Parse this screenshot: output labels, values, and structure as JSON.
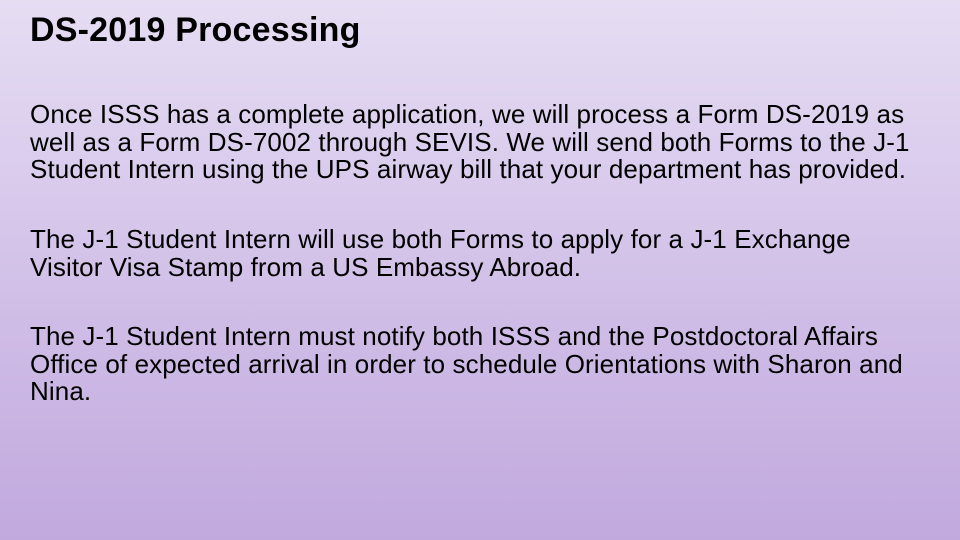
{
  "title": "DS-2019 Processing",
  "paragraphs": [
    "Once ISSS has a complete application, we will process a Form DS-2019 as well as a Form DS-7002 through SEVIS. We will send both Forms to the J-1 Student Intern using the UPS airway bill that your department has provided.",
    "The J-1 Student Intern will use both Forms to apply for a J-1 Exchange Visitor Visa Stamp from a US Embassy Abroad.",
    "The J-1 Student Intern must notify both ISSS and the Postdoctoral Affairs Office of expected arrival in order to schedule Orientations with Sharon and Nina."
  ]
}
